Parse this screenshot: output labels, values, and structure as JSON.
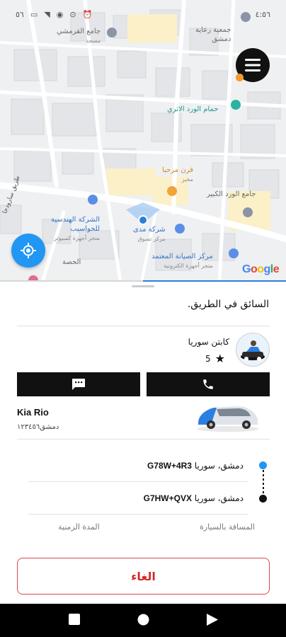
{
  "status_bar": {
    "time": "٤:٥٦",
    "battery": "٥٦"
  },
  "map": {
    "pois": {
      "qirmishi": "جامع القرمشي",
      "qirmishi_sub": "مسجد",
      "care_society": "جمعية رعاية",
      "care_society_2": "دمشق",
      "hammam": "حمام الورد الاثري",
      "bakery": "فرن مرحبا",
      "bakery_sub": "مخبز",
      "big_mosque": "جامع الورد الكبير",
      "engineering": "الشركة الهندسية",
      "engineering_2": "للحواسيب",
      "engineering_sub": "متجر أجهزة كمبيوتر",
      "mada": "شركة مدى",
      "mada_sub": "مركز تسوق",
      "maintenance": "مركز الصيانة المعتمد",
      "maintenance_sub": "متجر أجهزة الكترونية",
      "hisa": "الحصة"
    },
    "road": "طريق سارودجا",
    "google": [
      "G",
      "o",
      "o",
      "g",
      "l",
      "e"
    ],
    "progress_fraction": 0.5
  },
  "sheet": {
    "status_message": "السائق في الطريق.",
    "driver": {
      "name": "كابتن  سوريا",
      "rating": "5"
    },
    "car": {
      "name": "Kia Rio",
      "plate": "دمشق١٢٣٤٥٦"
    },
    "route": {
      "pickup": {
        "city": "دمشق، سوريا ",
        "code": "G78W+4R3"
      },
      "dropoff": {
        "city": "دمشق، سوريا ",
        "code": "G7HW+QVX"
      }
    },
    "metrics": {
      "distance_label": "المسافة بالسيارة",
      "duration_label": "المدة الزمنية"
    },
    "cancel_label": "الغاء"
  },
  "colors": {
    "accent_blue": "#2196f3",
    "cancel_red": "#d32b2b",
    "menu_dot": "#f59a2c"
  },
  "icons": [
    "wifi-icon",
    "eye-icon",
    "location-icon",
    "alarm-icon",
    "menu-icon",
    "my-location-icon",
    "chat-icon",
    "phone-icon",
    "star-icon",
    "back-icon",
    "home-icon",
    "recents-icon"
  ]
}
